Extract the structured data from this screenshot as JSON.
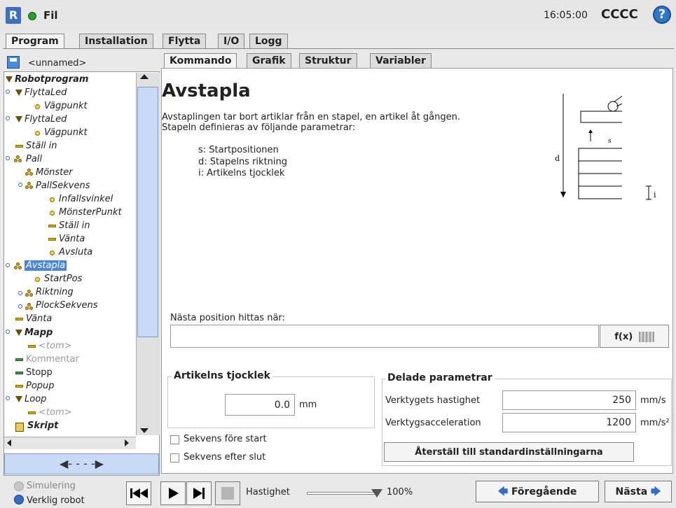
{
  "header": {
    "file_label": "Fil",
    "time": "16:05:00",
    "robot_name": "CCCC",
    "help": "?"
  },
  "main_tabs": [
    {
      "label": "Program"
    },
    {
      "label": "Installation"
    },
    {
      "label": "Flytta"
    },
    {
      "label": "I/O"
    },
    {
      "label": "Logg"
    }
  ],
  "program": {
    "name": "<unnamed>"
  },
  "tree": [
    {
      "label": "Robotprogram"
    },
    {
      "label": "FlyttaLed"
    },
    {
      "label": "Vägpunkt"
    },
    {
      "label": "FlyttaLed"
    },
    {
      "label": "Vägpunkt"
    },
    {
      "label": "Ställ in"
    },
    {
      "label": "Pall"
    },
    {
      "label": "Mönster"
    },
    {
      "label": "PallSekvens"
    },
    {
      "label": "Infallsvinkel"
    },
    {
      "label": "MönsterPunkt"
    },
    {
      "label": "Ställ in"
    },
    {
      "label": "Vänta"
    },
    {
      "label": "Avsluta"
    },
    {
      "label": "Avstapla"
    },
    {
      "label": "StartPos"
    },
    {
      "label": "Riktning"
    },
    {
      "label": "PlockSekvens"
    },
    {
      "label": "Vänta"
    },
    {
      "label": "Mapp"
    },
    {
      "label": "<tom>"
    },
    {
      "label": "Kommentar"
    },
    {
      "label": "Stopp"
    },
    {
      "label": "Popup"
    },
    {
      "label": "Loop"
    },
    {
      "label": "<tom>"
    },
    {
      "label": "Skript"
    }
  ],
  "sub_tabs": [
    {
      "label": "Kommando"
    },
    {
      "label": "Grafik"
    },
    {
      "label": "Struktur"
    },
    {
      "label": "Variabler"
    }
  ],
  "command": {
    "title": "Avstapla",
    "desc1": "Avstaplingen tar bort artiklar från en stapel, en artikel åt gången.",
    "desc2": "Stapeln definieras av följande parametrar:",
    "param_s": "s: Startpositionen",
    "param_d": "d: Stapelns riktning",
    "param_i": "i: Artikelns tjocklek",
    "diagram": {
      "s": "s",
      "d": "d",
      "i": "i"
    },
    "next_label": "Nästa position hittas när:",
    "next_value": "",
    "fx_label": "f(x)",
    "thickness": {
      "title": "Artikelns tjocklek",
      "value": "0.0",
      "unit": "mm"
    },
    "shared": {
      "title": "Delade parametrar",
      "speed_label": "Verktygets hastighet",
      "speed_value": "250",
      "speed_unit": "mm/s",
      "acc_label": "Verktygsacceleration",
      "acc_value": "1200",
      "acc_unit": "mm/s²",
      "reset": "Återställ till standardinställningarna"
    },
    "seq_before": "Sekvens före start",
    "seq_after": "Sekvens efter slut"
  },
  "bottom": {
    "simulation": "Simulering",
    "real_robot": "Verklig robot",
    "speed_label": "Hastighet",
    "speed_pct": "100%",
    "speed_fraction": 1.0,
    "prev": "Föregående",
    "next": "Nästa"
  }
}
